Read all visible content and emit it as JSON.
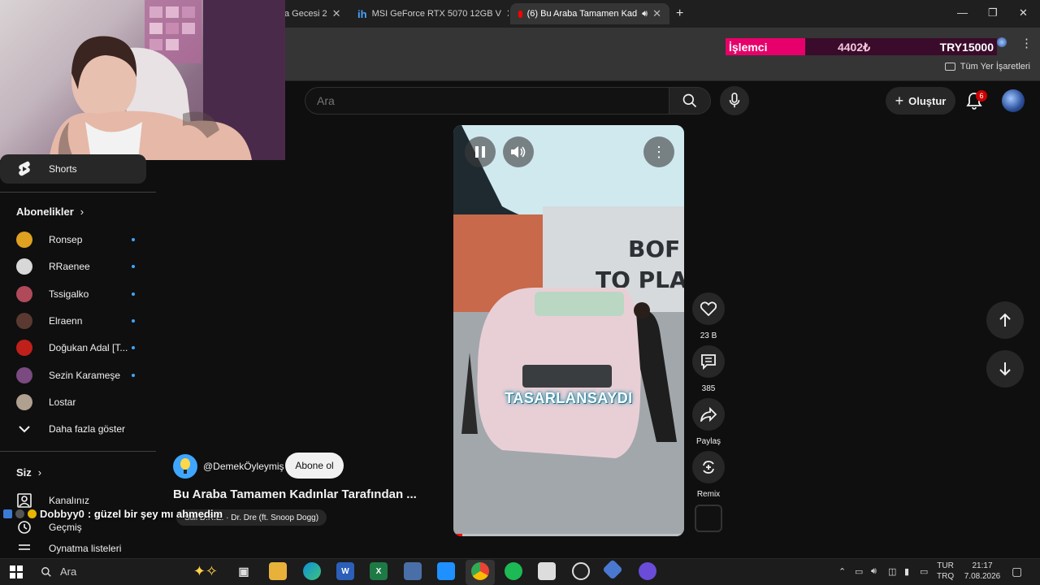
{
  "browser": {
    "tabs": [
      {
        "label": "a Gecesi 2",
        "icon": "generic"
      },
      {
        "label": "MSI GeForce RTX 5070 12GB V",
        "icon": "ih-icon"
      },
      {
        "label": "(6) Bu Araba Tamamen Kad",
        "icon": "youtube-icon",
        "active": true
      }
    ],
    "new_tab": "+",
    "window_controls": {
      "minimize": "—",
      "maximize": "❐",
      "close": "✕"
    },
    "bookmarks_all": "Tüm Yer İşaretleri"
  },
  "ticker": {
    "label": "İşlemci",
    "value1": "4402₺",
    "value2": "TRY15000"
  },
  "header": {
    "search_placeholder": "Ara",
    "create_label": "Oluştur",
    "notification_count": "6"
  },
  "sidebar": {
    "shorts_label": "Shorts",
    "subscriptions_heading": "Abonelikler",
    "subscriptions": [
      {
        "name": "Ronsep",
        "color": "#e0a020"
      },
      {
        "name": "RRaenee",
        "color": "#d8d8d8"
      },
      {
        "name": "Tssigalko",
        "color": "#b04a5a"
      },
      {
        "name": "Elraenn",
        "color": "#5a3a30"
      },
      {
        "name": "Doğukan Adal [T...",
        "color": "#c0201a"
      },
      {
        "name": "Sezin Karameşe",
        "color": "#7a4a80"
      },
      {
        "name": "Lostar",
        "color": "#b0a090",
        "no_dot": true
      }
    ],
    "show_more": "Daha fazla göster",
    "you_heading": "Siz",
    "you_items": [
      "Kanalınız",
      "Geçmiş",
      "Oynatma listeleri"
    ]
  },
  "video": {
    "caption": "TASARLANSAYDI",
    "progress": 0.04,
    "likes": "23 B",
    "comments": "385",
    "share": "Paylaş",
    "remix": "Remix",
    "channel": "@DemekÖyleymiş",
    "subscribe": "Abone ol",
    "title": "Bu Araba Tamamen Kadınlar Tarafından ...",
    "music": "Still D.R.E. · Dr. Dre (ft. Snoop Dogg)"
  },
  "chat": {
    "user": "Dobbyy0",
    "message": ": güzel bir şey mı ahmedim"
  },
  "taskbar": {
    "search_placeholder": "Ara",
    "lang_top": "TUR",
    "lang_bottom": "TRQ",
    "time": "21:17",
    "date": "7.08.2026"
  }
}
